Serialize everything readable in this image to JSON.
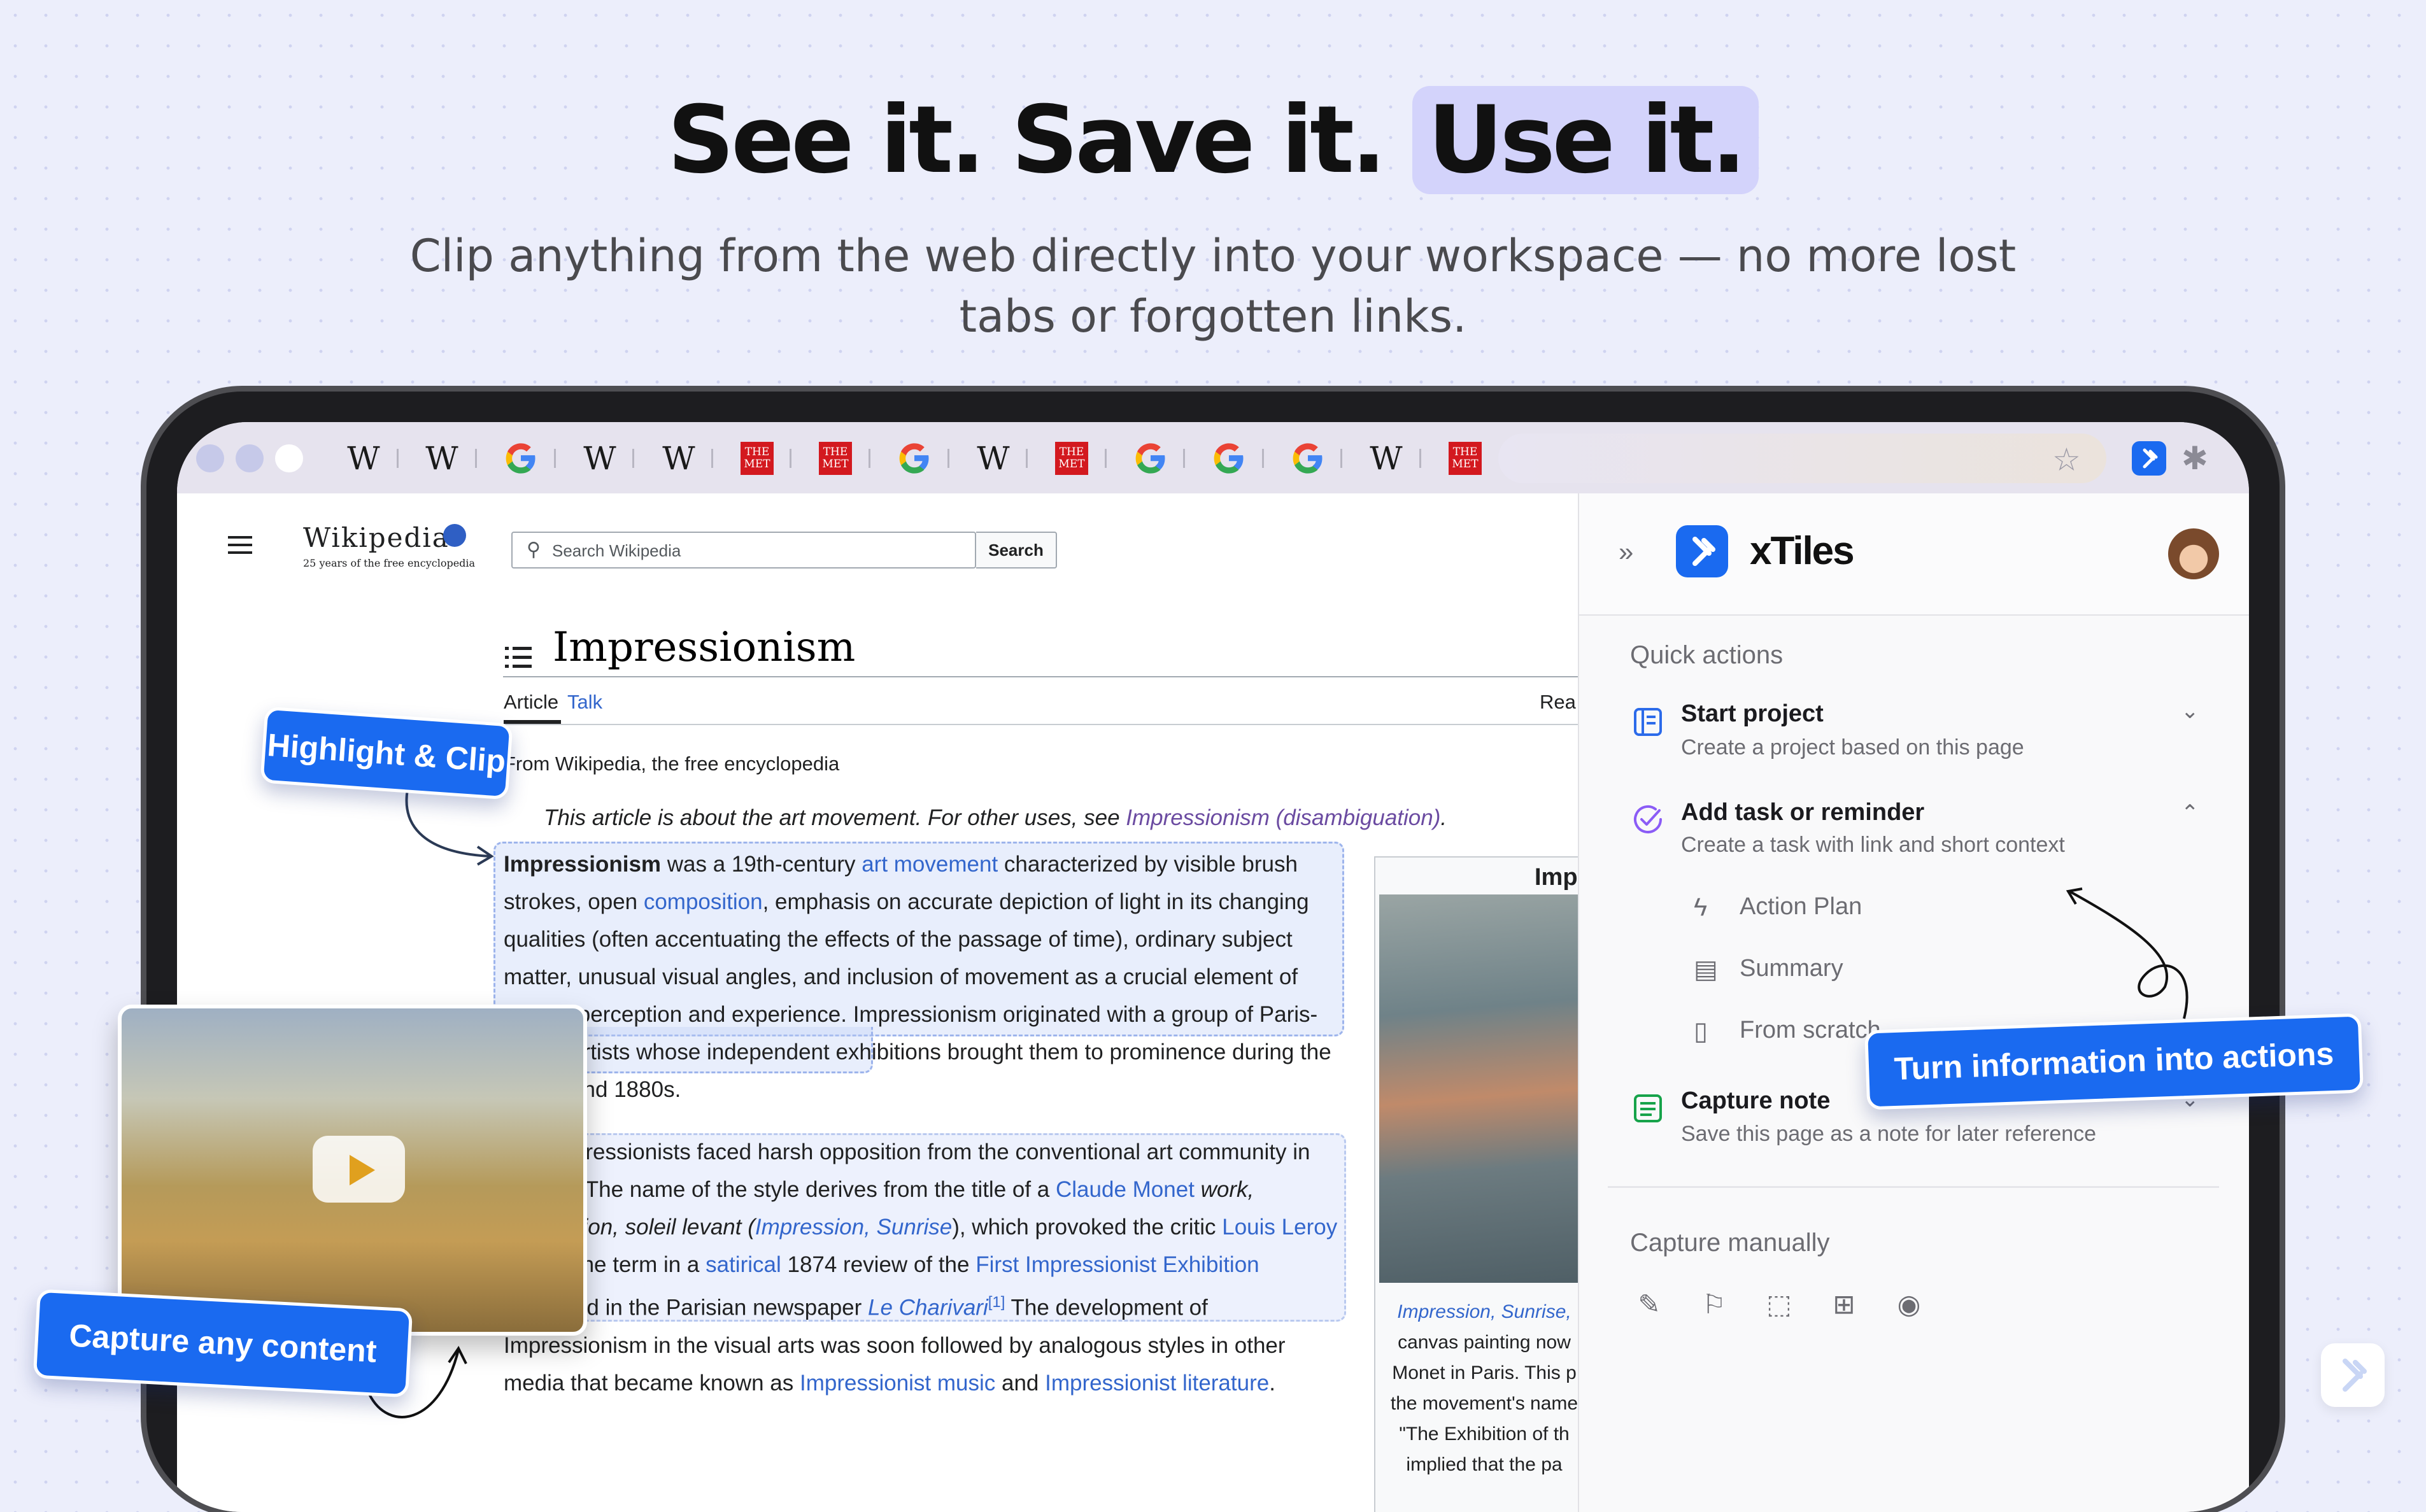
{
  "hero": {
    "title_part1": "See it. Save it. ",
    "title_part2": "Use it.",
    "subtitle": "Clip anything from the web directly into your workspace — no more lost tabs or forgotten links."
  },
  "browser": {
    "tabs": [
      "W",
      "W",
      "G",
      "W",
      "W",
      "THE MET",
      "THE MET",
      "G",
      "W",
      "THE MET",
      "G",
      "G",
      "G",
      "W",
      "THE MET"
    ],
    "met_label": "THE\nMET"
  },
  "wikipedia": {
    "logo": "Wikipedia",
    "tagline": "25 years of the free encyclopedia",
    "search_placeholder": "Search Wikipedia",
    "search_button": "Search",
    "article_title": "Impressionism",
    "tab_article": "Article",
    "tab_talk": "Talk",
    "tab_read": "Rea",
    "from": "From Wikipedia, the free encyclopedia",
    "hatnote_pre": "This article is about the art movement. For other uses, see ",
    "hatnote_link": "Impressionism (disambiguation)",
    "hatnote_post": ".",
    "para1": {
      "bold": "Impressionism",
      "t1": " was a 19th-century ",
      "l1": "art movement",
      "t2": " characterized by visible brush strokes, open ",
      "l2": "composition",
      "t3": ", emphasis on accurate depiction of light in its changing qualities (often accentuating the effects of the passage of time), ordinary subject matter, unusual visual angles, and inclusion of movement as a crucial element of human perception and experience. Impressionism originated with a group of Paris-based artists whose independent exhibitions brought them to prominence during the 1870s and 1880s."
    },
    "para2": {
      "t1": "The Impressionists faced harsh opposition from the conventional art community in France. The name of the style derives from the title of a ",
      "l1": "Claude Monet",
      "t2": " work, Impression, soleil levant (",
      "l2": "Impression, Sunrise",
      "t3": "), which provoked the critic ",
      "l3": "Louis Leroy",
      "t4": " to coin the term in a ",
      "l4": "satirical",
      "t5": " 1874 review of the ",
      "l5": "First Impressionist Exhibition",
      "t6": " published in the Parisian newspaper ",
      "l6": "Le Charivari",
      "sup": "[1]",
      "t7": " The development of Impressionism in the visual arts was soon followed by analogous styles in other media that became known as ",
      "l7": "Impressionist music",
      "t8": " and ",
      "l8": "Impressionist literature",
      "t9": "."
    },
    "infobox_title": "Impr",
    "infobox_caption_link": "Impression, Sunrise,",
    "infobox_caption": [
      "canvas painting now",
      "Monet in Paris. This p",
      "the movement's name",
      "\"The Exhibition of th",
      "implied that the pa"
    ]
  },
  "panel": {
    "brand": "xTiles",
    "quick_actions_header": "Quick actions",
    "actions": [
      {
        "title": "Start project",
        "desc": "Create a project based on this page"
      },
      {
        "title": "Add task or reminder",
        "desc": "Create a task with link and short context"
      },
      {
        "title": "Capture note",
        "desc": "Save this page as a note for later reference"
      }
    ],
    "sub_items": [
      "Action Plan",
      "Summary",
      "From scratch"
    ],
    "capture_manually_header": "Capture manually"
  },
  "callouts": {
    "highlight": "Highlight & Clip",
    "capture": "Capture any content",
    "turn_info": "Turn information into actions"
  },
  "colors": {
    "accent": "#1a6af0",
    "link": "#3366cc",
    "background": "#eceefb",
    "highlight": "#d3d3fb"
  }
}
